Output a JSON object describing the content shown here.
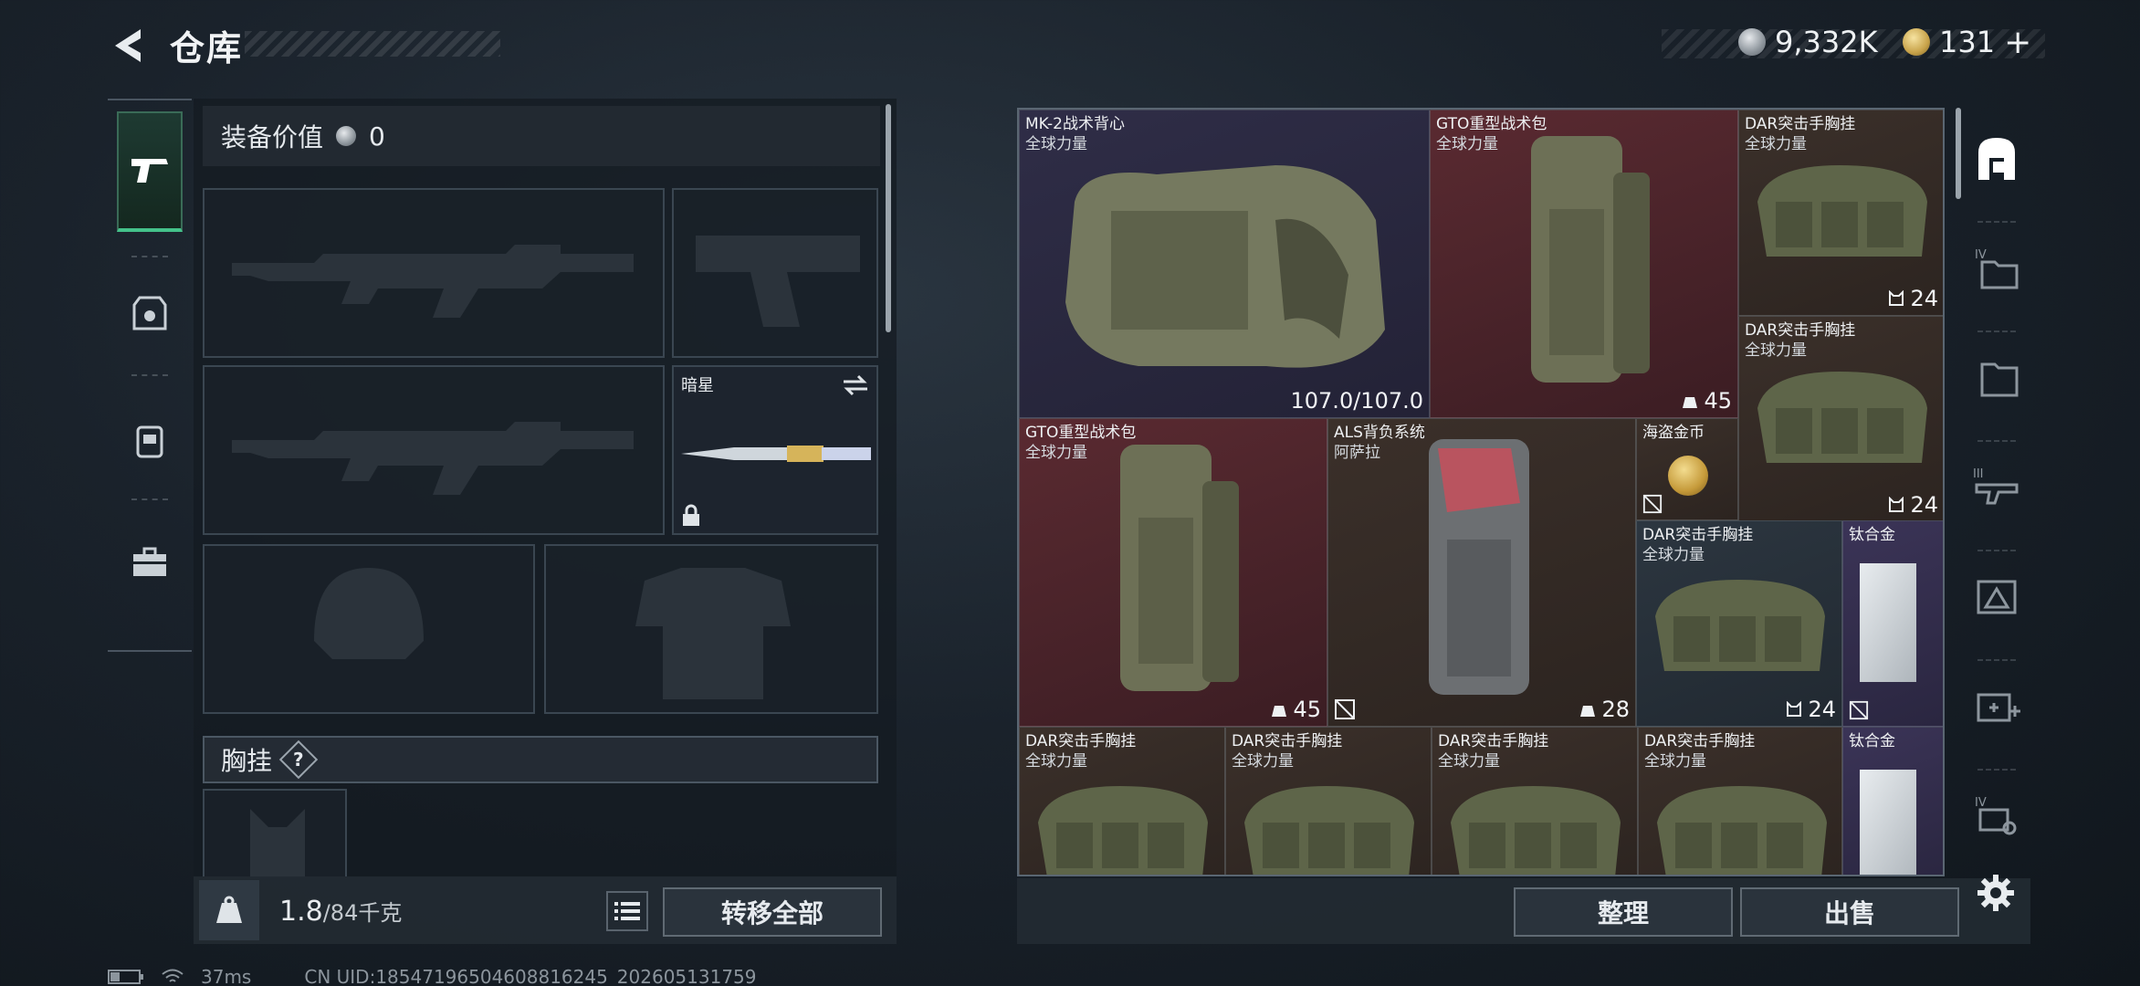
{
  "header": {
    "title": "仓库",
    "currencies": [
      {
        "icon": "silver-coin-icon",
        "value": "9,332K"
      },
      {
        "icon": "gold-coin-icon",
        "value": "131"
      }
    ],
    "add_symbol": "+"
  },
  "categories": [
    {
      "name": "weapons",
      "icon": "pistol-icon",
      "active": true
    },
    {
      "name": "armor",
      "icon": "vest-icon",
      "active": false
    },
    {
      "name": "backpack",
      "icon": "backpack-icon",
      "active": false
    },
    {
      "name": "toolbox",
      "icon": "toolbox-icon",
      "active": false
    }
  ],
  "equipment": {
    "value_label": "装备价值",
    "value": "0",
    "melee_name": "暗星",
    "chest_rig_label": "胸挂",
    "chest_rig_help": "?",
    "weight_current": "1.8",
    "weight_sep_max": "/84千克",
    "transfer_all": "转移全部"
  },
  "stash": {
    "items": [
      {
        "name": "MK-2战术背心",
        "sub": "全球力量",
        "stat": "107.0/107.0",
        "bg": "purple"
      },
      {
        "name": "GTO重型战术包",
        "sub": "全球力量",
        "stat": "45",
        "bg": "red"
      },
      {
        "name": "DAR突击手胸挂",
        "sub": "全球力量",
        "stat": "24",
        "bg": "brown"
      },
      {
        "name": "DAR突击手胸挂",
        "sub": "全球力量",
        "stat": "24",
        "bg": "brown"
      },
      {
        "name": "GTO重型战术包",
        "sub": "全球力量",
        "stat": "45",
        "bg": "red"
      },
      {
        "name": "ALS背负系统",
        "sub": "阿萨拉",
        "stat": "28",
        "bg": "brown"
      },
      {
        "name": "海盗金币",
        "sub": "",
        "stat": "",
        "bg": "brown"
      },
      {
        "name": "DAR突击手胸挂",
        "sub": "全球力量",
        "stat": "24",
        "bg": "grey"
      },
      {
        "name": "钛合金",
        "sub": "",
        "stat": "",
        "bg": "violet"
      },
      {
        "name": "DAR突击手胸挂",
        "sub": "全球力量",
        "stat": "",
        "bg": "brown"
      },
      {
        "name": "DAR突击手胸挂",
        "sub": "全球力量",
        "stat": "",
        "bg": "brown"
      },
      {
        "name": "DAR突击手胸挂",
        "sub": "全球力量",
        "stat": "",
        "bg": "brown"
      },
      {
        "name": "DAR突击手胸挂",
        "sub": "全球力量",
        "stat": "",
        "bg": "brown"
      },
      {
        "name": "钛合金",
        "sub": "",
        "stat": "",
        "bg": "violet"
      }
    ],
    "sort_label": "整理",
    "sell_label": "出售"
  },
  "sidebar": [
    {
      "icon": "stash-home-icon"
    },
    {
      "icon": "folder-iv-icon"
    },
    {
      "icon": "folder-icon"
    },
    {
      "icon": "rifle-iii-icon"
    },
    {
      "icon": "warning-case-icon"
    },
    {
      "icon": "medkit-plus-icon"
    },
    {
      "icon": "key-iv-icon"
    }
  ],
  "status": {
    "ping": "37ms",
    "uid": "CN UID:18547196504608816245_202605131759"
  },
  "colors": {
    "accent_green": "#44c28a",
    "rarity_red": "#5a2a31",
    "rarity_purple": "#2f2d47",
    "rarity_brown": "#3b302a"
  }
}
